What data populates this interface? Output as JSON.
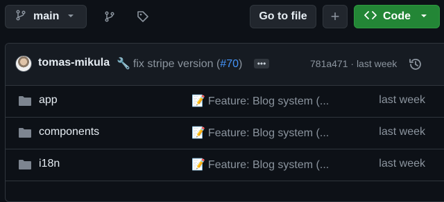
{
  "toolbar": {
    "branch_label": "main",
    "goto_file_label": "Go to file",
    "plus_label": "+",
    "code_label": "Code",
    "code_button_color": "#238636"
  },
  "commit": {
    "author": "tomas-mikula",
    "message_prefix": "fix stripe version (",
    "pr_link": "#70",
    "message_suffix": ")",
    "ellipsis": "•••",
    "sha_time": "781a471 · last week"
  },
  "files": [
    {
      "name": "app",
      "message": "Feature: Blog system (...",
      "time": "last week",
      "icon": "folder-icon"
    },
    {
      "name": "components",
      "message": "Feature: Blog system (...",
      "time": "last week",
      "icon": "folder-icon"
    },
    {
      "name": "i18n",
      "message": "Feature: Blog system (...",
      "time": "last week",
      "icon": "folder-icon"
    }
  ]
}
